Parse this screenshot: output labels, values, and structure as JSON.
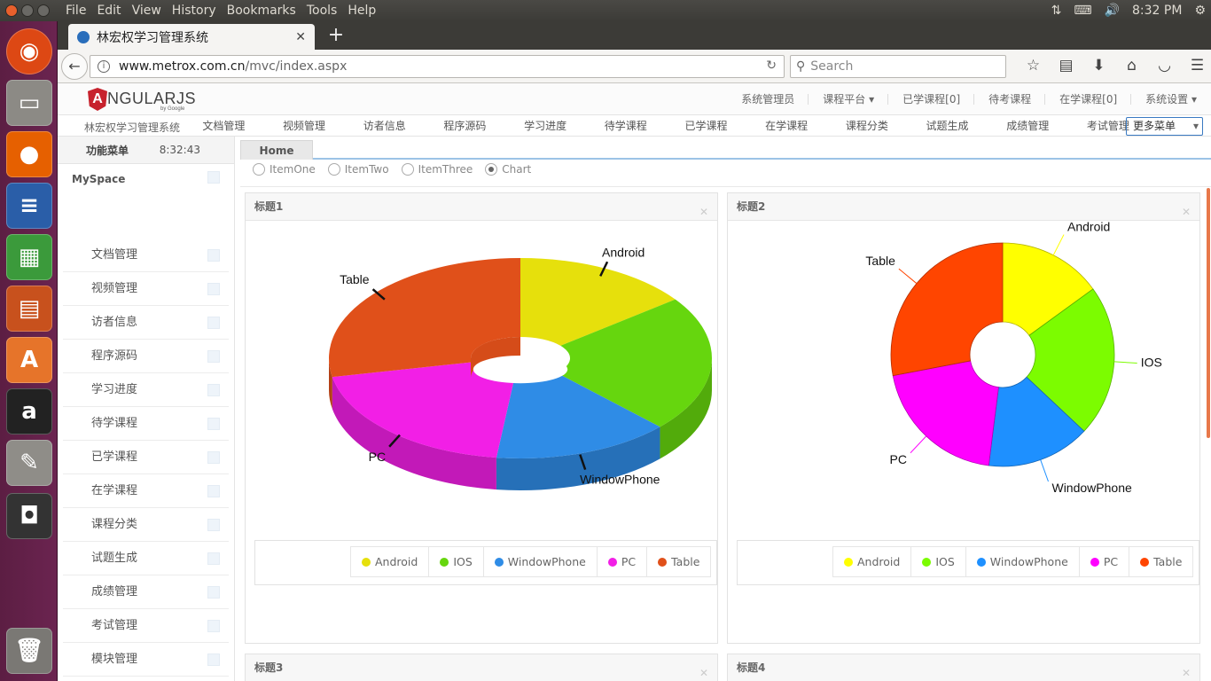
{
  "system": {
    "menu": [
      "File",
      "Edit",
      "View",
      "History",
      "Bookmarks",
      "Tools",
      "Help"
    ],
    "clock": "8:32 PM"
  },
  "browser": {
    "tab_title": "林宏权学习管理系统",
    "url_host": "www.metrox.com.cn",
    "url_path": "/mvc/index.aspx",
    "search_placeholder": "Search"
  },
  "app": {
    "logo_text": "NGULARJS",
    "logo_letter": "A",
    "logo_by": "by Google",
    "header_nav": [
      "系统管理员",
      "课程平台 ▾",
      "已学课程[0]",
      "待考课程",
      "在学课程[0]",
      "系统设置 ▾"
    ],
    "subnav_title": "林宏权学习管理系统",
    "subnav_items": [
      "文档管理",
      "视频管理",
      "访者信息",
      "程序源码",
      "学习进度",
      "待学课程",
      "已学课程",
      "在学课程",
      "课程分类",
      "试题生成",
      "成绩管理",
      "考试管理"
    ],
    "more_menu": "更多菜单"
  },
  "sidebar": {
    "header_label": "功能菜单",
    "time": "8:32:43",
    "myspace": "MySpace",
    "items": [
      "文档管理",
      "视频管理",
      "访者信息",
      "程序源码",
      "学习进度",
      "待学课程",
      "已学课程",
      "在学课程",
      "课程分类",
      "试题生成",
      "成绩管理",
      "考试管理",
      "模块管理"
    ]
  },
  "main": {
    "home_tab": "Home",
    "radios": [
      {
        "label": "ItemOne",
        "checked": false
      },
      {
        "label": "ItemTwo",
        "checked": false
      },
      {
        "label": "ItemThree",
        "checked": false
      },
      {
        "label": "Chart",
        "checked": true
      }
    ],
    "panels": [
      "标题1",
      "标题2",
      "标题3",
      "标题4"
    ]
  },
  "chart_data": [
    {
      "type": "pie",
      "title": "标题1",
      "style": "3d-donut",
      "categories": [
        "Android",
        "IOS",
        "WindowPhone",
        "PC",
        "Table"
      ],
      "values": [
        15,
        22,
        15,
        20,
        28
      ],
      "colors": [
        "#e6e00c",
        "#66d60e",
        "#2f8ce6",
        "#f21fe6",
        "#e0501a"
      ],
      "labels_shown": [
        "Android",
        "WindowPhone",
        "PC",
        "Table"
      ]
    },
    {
      "type": "pie",
      "title": "标题2",
      "style": "donut",
      "categories": [
        "Android",
        "IOS",
        "WindowPhone",
        "PC",
        "Table"
      ],
      "values": [
        15,
        22,
        15,
        20,
        28
      ],
      "colors": [
        "#ffff00",
        "#7cfc00",
        "#1e90ff",
        "#ff00ff",
        "#ff4500"
      ],
      "labels_shown": [
        "Android",
        "IOS",
        "WindowPhone",
        "PC",
        "Table"
      ]
    }
  ]
}
